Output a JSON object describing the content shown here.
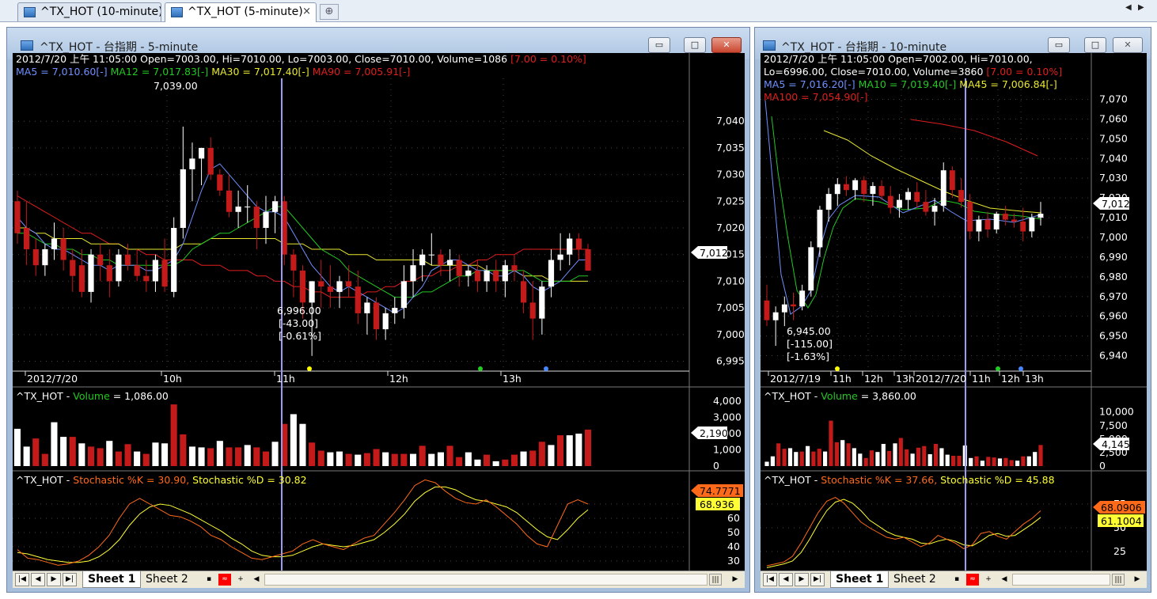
{
  "tabs": [
    {
      "label": "^TX_HOT (10-minute)",
      "active": false
    },
    {
      "label": "^TX_HOT (5-minute)",
      "active": true,
      "close": "×"
    }
  ],
  "tab_add": "⊕",
  "nav": {
    "left": "◀",
    "right": "▶"
  },
  "colors": {
    "bg": "#000000",
    "up": "#ffffff",
    "down": "#c41a1a",
    "ma5": "#6f8fff",
    "ma12": "#22c822",
    "ma30": "#e8e830",
    "ma90": "#e01e1e",
    "vol_label": "#22c822",
    "k": "#ff6a1a",
    "d": "#ffff33",
    "cursor": "#9a9aee"
  },
  "win1": {
    "title": "^TX_HOT - 台指期 - 5-minute",
    "buttons": {
      "min": "▭",
      "max": "□",
      "close": "✕"
    },
    "info": {
      "line1a": "2012/7/20 上午 11:05:00 Open=7003.00, Hi=7010.00, Lo=7003.00, Close=7010.00,  Volume=1086 ",
      "line1b": "[7.00 = 0.10%]",
      "ma5": "MA5 = 7,010.60[-]",
      "ma12": "MA12 = 7,017.83[-]",
      "ma30": "MA30 = 7,017.40[-]",
      "ma90": "MA90 = 7,005.91[-]"
    },
    "yticks": [
      "7,040",
      "7,035",
      "7,030",
      "7,025",
      "7,020",
      "7,015",
      "7,010",
      "7,005",
      "7,000",
      "6,995"
    ],
    "price_tag": "7,012",
    "xticks": [
      "2012/7/20",
      "10h",
      "11h",
      "12h",
      "13h"
    ],
    "annot": {
      "high": "7,039.00",
      "low": "6,996.00",
      "chg": "[-43.00]",
      "pct": "[-0.61%]"
    },
    "vol": {
      "prefix": "^TX_HOT - ",
      "name": "Volume",
      "value": " = 1,086.00",
      "yticks": [
        "4,000",
        "3,000",
        "2,000",
        "1,000",
        "0"
      ],
      "tag": "2,190"
    },
    "stoch": {
      "prefix": "^TX_HOT - ",
      "k": "Stochastic %K = 30.90,",
      "d": " Stochastic %D = 30.82",
      "yticks": [
        "70",
        "60",
        "50",
        "40",
        "30"
      ],
      "tag_k": "74.7771",
      "tag_d": "68.936"
    },
    "sheets": [
      "Sheet 1",
      "Sheet 2"
    ]
  },
  "win2": {
    "title": "^TX_HOT - 台指期 - 10-minute",
    "buttons": {
      "min": "▭",
      "max": "□",
      "close": "✕"
    },
    "info": {
      "line1": "2012/7/20 上午 11:05:00 Open=7002.00, Hi=7010.00,",
      "line2a": "Lo=6996.00, Close=7010.00,  Volume=3860 ",
      "line2b": "[7.00 = 0.10%]",
      "ma5": "MA5 = 7,016.20[-]",
      "ma10": "MA10 = 7,019.40[-]",
      "ma45": "MA45 = 7,006.84[-]",
      "ma100": "MA100 = 7,054.90[-]"
    },
    "yticks": [
      "7,070",
      "7,060",
      "7,050",
      "7,040",
      "7,030",
      "7,020",
      "7,010",
      "7,000",
      "6,990",
      "6,980",
      "6,970",
      "6,960",
      "6,950",
      "6,940"
    ],
    "price_tag": "7,012",
    "xticks": [
      "2012/7/19",
      "11h",
      "12h",
      "13h",
      "2012/7/20",
      "11h",
      "12h",
      "13h"
    ],
    "annot": {
      "low": "6,945.00",
      "chg": "[-115.00]",
      "pct": "[-1.63%]"
    },
    "vol": {
      "prefix": "^TX_HOT - ",
      "name": "Volume",
      "value": " = 3,860.00",
      "yticks": [
        "10,000",
        "7,500",
        "5,000",
        "2,500",
        "0"
      ],
      "tag": "4,145"
    },
    "stoch": {
      "prefix": "^TX_HOT - ",
      "k": "Stochastic %K = 37.66,",
      "d": " Stochastic %D = 45.88",
      "yticks": [
        "75",
        "50",
        "25"
      ],
      "tag_k": "68.0906",
      "tag_d": "61.1004"
    },
    "sheets": [
      "Sheet 1",
      "Sheet 2"
    ]
  },
  "chart_data": [
    {
      "type": "candlestick",
      "title": "^TX_HOT - 台指期 - 5-minute",
      "ylim": [
        6993,
        7043
      ],
      "candles": [
        [
          7025,
          7027,
          7017,
          7019
        ],
        [
          7020,
          7025,
          7013,
          7016
        ],
        [
          7016,
          7018,
          7011,
          7013
        ],
        [
          7013,
          7017,
          7011,
          7016
        ],
        [
          7016,
          7021,
          7014,
          7018
        ],
        [
          7018,
          7020,
          7012,
          7014
        ],
        [
          7014,
          7016,
          7008,
          7011
        ],
        [
          7013,
          7016,
          7007,
          7008
        ],
        [
          7008,
          7016,
          7006,
          7015
        ],
        [
          7015,
          7017,
          7010,
          7013
        ],
        [
          7013,
          7016,
          7007,
          7010
        ],
        [
          7010,
          7016,
          7009,
          7015
        ],
        [
          7015,
          7017,
          7012,
          7013
        ],
        [
          7013,
          7016,
          7010,
          7011
        ],
        [
          7011,
          7014,
          7008,
          7010
        ],
        [
          7010,
          7015,
          7008,
          7014
        ],
        [
          7014,
          7018,
          7008,
          7009
        ],
        [
          7008,
          7022,
          7007,
          7020
        ],
        [
          7020,
          7039,
          7018,
          7031
        ],
        [
          7031,
          7036,
          7025,
          7033
        ],
        [
          7033,
          7035,
          7028,
          7035
        ],
        [
          7035,
          7037,
          7029,
          7030
        ],
        [
          7030,
          7031,
          7026,
          7027
        ],
        [
          7027,
          7030,
          7022,
          7023
        ],
        [
          7023,
          7027,
          7020,
          7024
        ],
        [
          7024,
          7028,
          7021,
          7024
        ],
        [
          7024,
          7025,
          7016,
          7020
        ],
        [
          7020,
          7026,
          7017,
          7023
        ],
        [
          7023,
          7026,
          7019,
          7025
        ],
        [
          7025,
          7026,
          7013,
          7015
        ],
        [
          7015,
          7016,
          7007,
          7012
        ],
        [
          7012,
          7013,
          7003,
          7006
        ],
        [
          7006,
          7010,
          6996,
          7010
        ],
        [
          7010,
          7014,
          7005,
          7009
        ],
        [
          7009,
          7013,
          7005,
          7008
        ],
        [
          7008,
          7011,
          7005,
          7010
        ],
        [
          7010,
          7013,
          7007,
          7009
        ],
        [
          7009,
          7012,
          7002,
          7004
        ],
        [
          7004,
          7007,
          7000,
          7006
        ],
        [
          7006,
          7007,
          6999,
          7001
        ],
        [
          7001,
          7005,
          6999,
          7004
        ],
        [
          7004,
          7007,
          7002,
          7005
        ],
        [
          7005,
          7013,
          7003,
          7010
        ],
        [
          7010,
          7016,
          7007,
          7013
        ],
        [
          7013,
          7016,
          7010,
          7015
        ],
        [
          7015,
          7019,
          7013,
          7015
        ],
        [
          7015,
          7016,
          7011,
          7013
        ],
        [
          7013,
          7016,
          7010,
          7014
        ],
        [
          7014,
          7015,
          7009,
          7011
        ],
        [
          7011,
          7013,
          7009,
          7012
        ],
        [
          7012,
          7014,
          7008,
          7010
        ],
        [
          7010,
          7013,
          7008,
          7012
        ],
        [
          7012,
          7014,
          7008,
          7010
        ],
        [
          7010,
          7014,
          7007,
          7013
        ],
        [
          7013,
          7015,
          7010,
          7012
        ],
        [
          7010,
          7012,
          7004,
          7006
        ],
        [
          7006,
          7010,
          6999,
          7003
        ],
        [
          7003,
          7010,
          7000,
          7009
        ],
        [
          7009,
          7016,
          7007,
          7014
        ],
        [
          7014,
          7019,
          7012,
          7015
        ],
        [
          7015,
          7019,
          7013,
          7018
        ],
        [
          7018,
          7019,
          7014,
          7016
        ],
        [
          7016,
          7017,
          7012,
          7012
        ]
      ],
      "ma5": [
        7022,
        7020,
        7019,
        7017,
        7016,
        7016,
        7015,
        7014,
        7013,
        7013,
        7012,
        7013,
        7013,
        7013,
        7012,
        7012,
        7013,
        7014,
        7017,
        7022,
        7027,
        7031,
        7032,
        7030,
        7028,
        7026,
        7024,
        7023,
        7023,
        7022,
        7019,
        7016,
        7013,
        7011,
        7009,
        7008,
        7009,
        7008,
        7007,
        7006,
        7005,
        7004,
        7005,
        7007,
        7009,
        7012,
        7013,
        7014,
        7014,
        7013,
        7012,
        7012,
        7011,
        7011,
        7012,
        7011,
        7009,
        7008,
        7009,
        7010,
        7012,
        7014,
        7014
      ],
      "ma12": [
        7019,
        7019,
        7018,
        7017,
        7017,
        7016,
        7016,
        7015,
        7015,
        7014,
        7014,
        7013,
        7013,
        7013,
        7013,
        7013,
        7013,
        7013,
        7014,
        7016,
        7017,
        7018,
        7019,
        7019,
        7020,
        7021,
        7022,
        7023,
        7024,
        7024,
        7022,
        7020,
        7018,
        7016,
        7015,
        7014,
        7012,
        7011,
        7010,
        7009,
        7008,
        7007,
        7007,
        7007,
        7008,
        7008,
        7009,
        7010,
        7011,
        7011,
        7012,
        7012,
        7012,
        7012,
        7012,
        7012,
        7011,
        7010,
        7010,
        7010,
        7010,
        7011,
        7011
      ],
      "ma30": [
        7020,
        7020,
        7019,
        7019,
        7018,
        7018,
        7018,
        7018,
        7017,
        7017,
        7017,
        7017,
        7016,
        7016,
        7016,
        7016,
        7016,
        7016,
        7017,
        7017,
        7017,
        7018,
        7018,
        7018,
        7018,
        7018,
        7018,
        7018,
        7018,
        7017,
        7017,
        7017,
        7016,
        7016,
        7016,
        7016,
        7015,
        7015,
        7015,
        7014,
        7014,
        7014,
        7014,
        7014,
        7014,
        7013,
        7013,
        7013,
        7013,
        7013,
        7013,
        7012,
        7012,
        7012,
        7012,
        7011,
        7011,
        7011,
        7010,
        7010,
        7010,
        7010,
        7010
      ],
      "ma90": [
        7026,
        7025,
        7024,
        7023,
        7022,
        7021,
        7020,
        7019,
        7019,
        7018,
        7017,
        7017,
        7016,
        7016,
        7015,
        7015,
        7014,
        7014,
        7014,
        7014,
        7013,
        7013,
        7013,
        7012,
        7012,
        7012,
        7011,
        7011,
        7010,
        7010,
        7009,
        7009,
        7008,
        7008,
        7007,
        7007,
        7007,
        7007,
        7008,
        7008,
        7009,
        7009,
        7010,
        7010,
        7011,
        7011,
        7012,
        7012,
        7013,
        7013,
        7014,
        7014,
        7015,
        7015,
        7015,
        7016,
        7016,
        7016,
        7016,
        7016,
        7016,
        7016,
        7016
      ],
      "volume": [
        2300,
        1200,
        1700,
        750,
        2700,
        1800,
        1800,
        1400,
        1200,
        1100,
        1550,
        900,
        1350,
        900,
        750,
        1450,
        1400,
        3800,
        1950,
        1200,
        1150,
        1100,
        1550,
        1150,
        1150,
        1300,
        1150,
        900,
        1500,
        2600,
        3200,
        2600,
        1450,
        950,
        850,
        900,
        750,
        700,
        800,
        1050,
        850,
        750,
        750,
        750,
        1250,
        750,
        850,
        1250,
        550,
        850,
        400,
        700,
        300,
        400,
        700,
        900,
        950,
        1500,
        1300,
        1900,
        1900,
        2000,
        2250
      ],
      "stoch_k": [
        38,
        32,
        31,
        29,
        27,
        28,
        30,
        34,
        40,
        48,
        60,
        70,
        74,
        70,
        66,
        62,
        61,
        58,
        54,
        48,
        45,
        40,
        36,
        32,
        31,
        33,
        35,
        37,
        42,
        45,
        42,
        40,
        38,
        42,
        46,
        48,
        56,
        64,
        73,
        83,
        87,
        85,
        79,
        74,
        71,
        70,
        73,
        68,
        62,
        56,
        48,
        42,
        40,
        55,
        70,
        73,
        70
      ],
      "stoch_d": [
        36,
        35,
        33,
        31,
        30,
        29,
        29,
        30,
        33,
        38,
        45,
        55,
        63,
        68,
        70,
        69,
        66,
        63,
        59,
        55,
        51,
        46,
        42,
        37,
        34,
        33,
        33,
        34,
        37,
        40,
        42,
        41,
        40,
        41,
        43,
        45,
        50,
        56,
        63,
        72,
        78,
        82,
        82,
        80,
        76,
        73,
        72,
        70,
        68,
        64,
        58,
        52,
        47,
        45,
        52,
        60,
        66
      ]
    },
    {
      "type": "candlestick",
      "title": "^TX_HOT - 台指期 - 10-minute",
      "ylim": [
        6935,
        7075
      ],
      "candles": [
        [
          6968,
          6976,
          6955,
          6958
        ],
        [
          6958,
          6965,
          6945,
          6962
        ],
        [
          6962,
          6970,
          6955,
          6966
        ],
        [
          6966,
          6972,
          6958,
          6965
        ],
        [
          6965,
          6976,
          6963,
          6973
        ],
        [
          6973,
          6998,
          6970,
          6995
        ],
        [
          6995,
          7016,
          6990,
          7014
        ],
        [
          7014,
          7025,
          7008,
          7022
        ],
        [
          7022,
          7030,
          7016,
          7027
        ],
        [
          7027,
          7031,
          7021,
          7024
        ],
        [
          7024,
          7030,
          7019,
          7029
        ],
        [
          7029,
          7031,
          7018,
          7022
        ],
        [
          7022,
          7028,
          7016,
          7026
        ],
        [
          7026,
          7029,
          7019,
          7021
        ],
        [
          7021,
          7026,
          7012,
          7015
        ],
        [
          7015,
          7022,
          7010,
          7019
        ],
        [
          7019,
          7025,
          7014,
          7023
        ],
        [
          7023,
          7028,
          7015,
          7018
        ],
        [
          7018,
          7024,
          7011,
          7013
        ],
        [
          7013,
          7020,
          7006,
          7016
        ],
        [
          7016,
          7038,
          7013,
          7034
        ],
        [
          7034,
          7036,
          7020,
          7024
        ],
        [
          7024,
          7030,
          7015,
          7018
        ],
        [
          7018,
          7022,
          6999,
          7003
        ],
        [
          7003,
          7011,
          6998,
          7009
        ],
        [
          7009,
          7013,
          7000,
          7004
        ],
        [
          7004,
          7013,
          7002,
          7012
        ],
        [
          7012,
          7016,
          7006,
          7009
        ],
        [
          7009,
          7012,
          7005,
          7008
        ],
        [
          7008,
          7015,
          6998,
          7003
        ],
        [
          7003,
          7012,
          7000,
          7010
        ],
        [
          7010,
          7018,
          7006,
          7012
        ]
      ],
      "volume": [
        800,
        1800,
        4200,
        3200,
        3300,
        2600,
        2700,
        3700,
        2700,
        3200,
        2700,
        8400,
        4400,
        4800,
        4200,
        3300,
        2300,
        1500,
        2900,
        2600,
        4100,
        2800,
        4200,
        5200,
        3100,
        2300,
        3400,
        3700,
        2200,
        4100,
        3300,
        2100,
        1900,
        1900,
        3800,
        1500,
        1800,
        1000,
        1700,
        1600,
        1400,
        1500,
        1100,
        1000,
        1800,
        1800,
        2600,
        3900
      ],
      "stoch_k": [
        10,
        12,
        14,
        20,
        34,
        50,
        66,
        78,
        82,
        76,
        66,
        56,
        50,
        45,
        40,
        38,
        40,
        35,
        30,
        34,
        42,
        38,
        34,
        28,
        32,
        44,
        46,
        41,
        38,
        46,
        54,
        60,
        68
      ],
      "stoch_d": [
        8,
        10,
        12,
        15,
        24,
        38,
        54,
        68,
        77,
        80,
        76,
        68,
        58,
        52,
        46,
        42,
        40,
        38,
        34,
        33,
        36,
        38,
        36,
        32,
        31,
        36,
        42,
        44,
        41,
        42,
        48,
        54,
        61
      ]
    }
  ]
}
